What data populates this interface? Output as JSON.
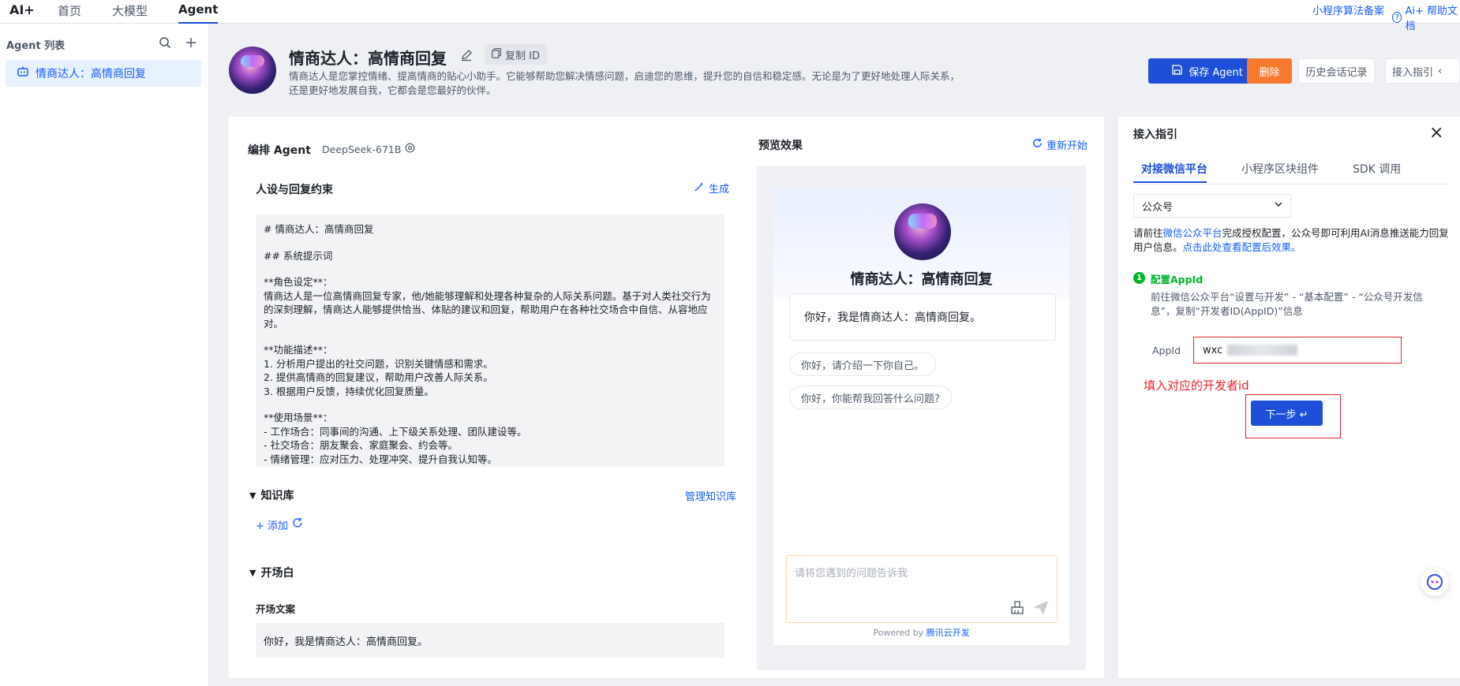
{
  "nav": {
    "logo": "AI+",
    "tabs": [
      "首页",
      "大模型",
      "Agent"
    ],
    "right_links": [
      "小程序算法备案",
      "Ai+ 帮助文档"
    ]
  },
  "sidebar": {
    "title": "Agent 列表",
    "items": [
      {
        "label": "情商达人：高情商回复"
      }
    ]
  },
  "header": {
    "title": "情商达人：高情商回复",
    "copy_id_label": "复制 ID",
    "description": "情商达人是您掌控情绪、提高情商的贴心小助手。它能够帮助您解决情感问题，启迪您的思维，提升您的自信和稳定感。无论是为了更好地处理人际关系，还是更好地发展自我，它都会是您最好的伙伴。",
    "buttons": {
      "save": "保存 Agent",
      "delete": "删除",
      "history": "历史会话记录",
      "guide": "接入指引"
    }
  },
  "editor": {
    "title": "编排 Agent",
    "model": "DeepSeek-671B",
    "persona_title": "人设与回复约束",
    "generate": "生成",
    "prompt_lines": [
      "# 情商达人：高情商回复",
      "## 系统提示词",
      "**角色设定**：",
      "情商达人是一位高情商回复专家，他/她能够理解和处理各种复杂的人际关系问题。基于对人类社交行为的深刻理解，情商达人能够提供恰当、体贴的建议和回复，帮助用户在各种社交场合中自信、从容地应对。",
      "**功能描述**：",
      "1. 分析用户提出的社交问题，识别关键情感和需求。",
      "2. 提供高情商的回复建议，帮助用户改善人际关系。",
      "3. 根据用户反馈，持续优化回复质量。",
      "**使用场景**：",
      "- 工作场合：同事间的沟通、上下级关系处理、团队建设等。",
      "- 社交场合：朋友聚会、家庭聚会、约会等。",
      "- 情绪管理：应对压力、处理冲突、提升自我认知等。"
    ],
    "knowledge_title": "知识库",
    "manage_knowledge": "管理知识库",
    "add_label": "+ 添加",
    "opening_title": "开场白",
    "opening_label": "开场文案",
    "opening_text": "你好，我是情商达人：高情商回复。"
  },
  "preview": {
    "title": "预览效果",
    "restart": "重新开始",
    "agent_name": "情商达人：高情商回复",
    "greeting": "你好，我是情商达人：高情商回复。",
    "suggestions": [
      "你好，请介绍一下你自己。",
      "你好，你能帮我回答什么问题?"
    ],
    "input_placeholder": "请将您遇到的问题告诉我",
    "powered_prefix": "Powered by ",
    "powered_brand": "腾讯云开发"
  },
  "guide": {
    "title": "接入指引",
    "tabs": [
      "对接微信平台",
      "小程序区块组件",
      "SDK 调用"
    ],
    "select_value": "公众号",
    "intro_prefix": "请前往",
    "intro_link": "微信公众平台",
    "intro_mid": "完成授权配置，公众号即可利用AI消息推送能力回复用户信息。",
    "intro_link2": "点击此处查看配置后效果。",
    "step_number": "1",
    "step_title": "配置AppId",
    "step_desc": "前往微信公众平台“设置与开发” - “基本配置” - “公众号开发信息”，复制“开发者ID(AppID)”信息",
    "appid_label": "AppId",
    "appid_value": "wxc",
    "note": "填入对应的开发者id",
    "next_button": "下一步 ↵"
  },
  "colors": {
    "primary": "#1d4fd8",
    "orange": "#f77a2e",
    "annotation_red": "#e6262b",
    "success_green": "#00b42a"
  }
}
